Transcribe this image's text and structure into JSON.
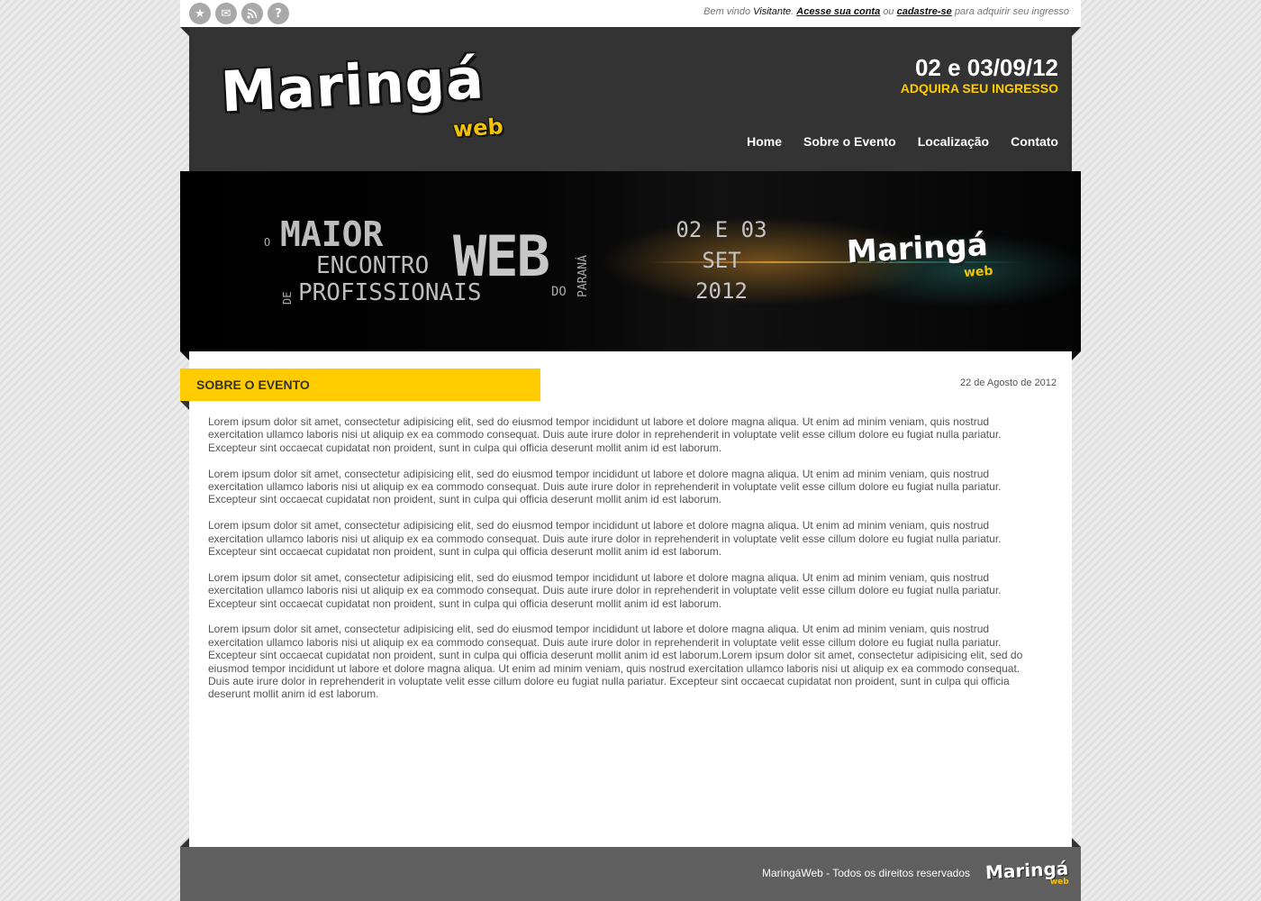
{
  "topbar": {
    "icons": [
      "star-icon",
      "mail-icon",
      "rss-icon",
      "help-icon"
    ],
    "welcome_prefix": "Bem vindo",
    "visitor": "Visitante",
    "login_link": "Acesse sua conta",
    "or": "ou",
    "register_link": "cadastre-se",
    "suffix": "para adquirir seu ingresso"
  },
  "header": {
    "logo_main": "Maringá",
    "logo_sub": "web",
    "event_dates": "02 e 03/09/12",
    "cta": "ADQUIRA SEU INGRESSO",
    "nav": [
      "Home",
      "Sobre o Evento",
      "Localização",
      "Contato"
    ]
  },
  "banner": {
    "o": "O",
    "maior": "MAIOR",
    "encontro": "ENCONTRO",
    "de": "DE",
    "profissionais": "PROFISSIONAIS",
    "web": "WEB",
    "do": "DO",
    "parana": "PARANÁ",
    "date_line1": "02 E 03",
    "date_line2": "SET",
    "date_line3": "2012",
    "logo_main": "Maringá",
    "logo_sub": "web"
  },
  "section": {
    "title": "SOBRE O EVENTO",
    "date": "22 de Agosto de 2012"
  },
  "paragraphs": [
    "Lorem ipsum dolor sit amet, consectetur adipisicing elit, sed do eiusmod tempor incididunt ut labore et dolore magna aliqua. Ut enim ad minim veniam, quis nostrud exercitation ullamco laboris nisi ut aliquip ex ea commodo consequat. Duis aute irure dolor in reprehenderit in voluptate velit esse cillum dolore eu fugiat nulla pariatur. Excepteur sint occaecat cupidatat non proident, sunt in culpa qui officia deserunt mollit anim id est laborum.",
    "Lorem ipsum dolor sit amet, consectetur adipisicing elit, sed do eiusmod tempor incididunt ut labore et dolore magna aliqua. Ut enim ad minim veniam, quis nostrud exercitation ullamco laboris nisi ut aliquip ex ea commodo consequat. Duis aute irure dolor in reprehenderit in voluptate velit esse cillum dolore eu fugiat nulla pariatur. Excepteur sint occaecat cupidatat non proident, sunt in culpa qui officia deserunt mollit anim id est laborum.",
    "Lorem ipsum dolor sit amet, consectetur adipisicing elit, sed do eiusmod tempor incididunt ut labore et dolore magna aliqua. Ut enim ad minim veniam, quis nostrud exercitation ullamco laboris nisi ut aliquip ex ea commodo consequat. Duis aute irure dolor in reprehenderit in voluptate velit esse cillum dolore eu fugiat nulla pariatur. Excepteur sint occaecat cupidatat non proident, sunt in culpa qui officia deserunt mollit anim id est laborum.",
    "Lorem ipsum dolor sit amet, consectetur adipisicing elit, sed do eiusmod tempor incididunt ut labore et dolore magna aliqua. Ut enim ad minim veniam, quis nostrud exercitation ullamco laboris nisi ut aliquip ex ea commodo consequat. Duis aute irure dolor in reprehenderit in voluptate velit esse cillum dolore eu fugiat nulla pariatur. Excepteur sint occaecat cupidatat non proident, sunt in culpa qui officia deserunt mollit anim id est laborum.",
    "Lorem ipsum dolor sit amet, consectetur adipisicing elit, sed do eiusmod tempor incididunt ut labore et dolore magna aliqua. Ut enim ad minim veniam, quis nostrud exercitation ullamco laboris nisi ut aliquip ex ea commodo consequat. Duis aute irure dolor in reprehenderit in voluptate velit esse cillum dolore eu fugiat nulla pariatur. Excepteur sint occaecat cupidatat non proident, sunt in culpa qui officia deserunt mollit anim id est laborum.Lorem ipsum dolor sit amet, consectetur adipisicing elit, sed do eiusmod tempor incididunt ut labore et dolore magna aliqua. Ut enim ad minim veniam, quis nostrud exercitation ullamco laboris nisi ut aliquip ex ea commodo consequat. Duis aute irure dolor in reprehenderit in voluptate velit esse cillum dolore eu fugiat nulla pariatur. Excepteur sint occaecat cupidatat non proident, sunt in culpa qui officia deserunt mollit anim id est laborum."
  ],
  "footer": {
    "text": "MaringáWeb - Todos os direitos reservados",
    "logo_main": "Maringá",
    "logo_sub": "web"
  },
  "colors": {
    "accent": "#ffcc00",
    "header_bg": "#333333",
    "footer_bg": "#5f5f5f"
  }
}
